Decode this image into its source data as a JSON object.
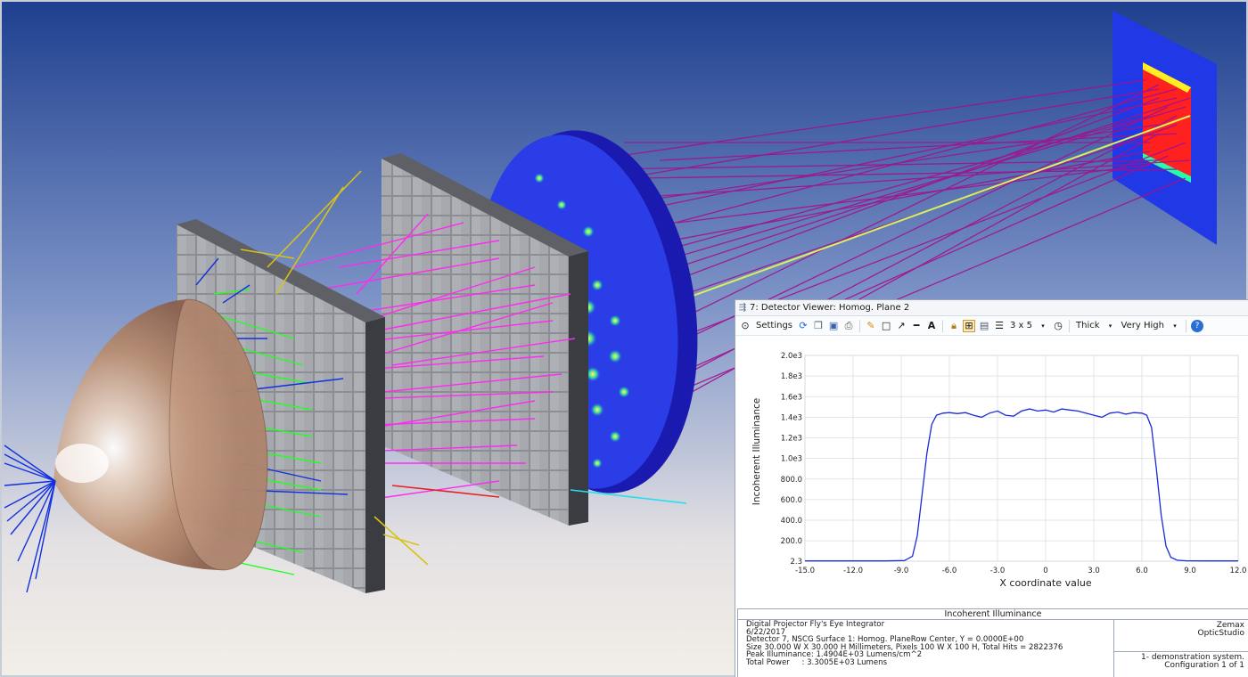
{
  "viewer": {
    "title": "7: Detector Viewer: Homog. Plane 2",
    "toolbar": {
      "settings_label": "Settings",
      "grid_label": "3 x 5",
      "thickness_label": "Thick",
      "quality_label": "Very High"
    }
  },
  "chart_data": {
    "type": "line",
    "xlabel": "X coordinate value",
    "ylabel": "Incoherent Illuminance",
    "xlim": [
      -15,
      12
    ],
    "ylim": [
      2.3,
      2000
    ],
    "x_ticks": [
      "-15.0",
      "-12.0",
      "-9.0",
      "-6.0",
      "-3.0",
      "0",
      "3.0",
      "6.0",
      "9.0",
      "12.0"
    ],
    "y_ticks": [
      "2.3",
      "200.0",
      "400.0",
      "600.0",
      "800.0",
      "1.0e3",
      "1.2e3",
      "1.4e3",
      "1.6e3",
      "1.8e3",
      "2.0e3"
    ],
    "series": [
      {
        "color": "#1a2bd6",
        "x": [
          -15,
          -10,
          -8.8,
          -8.3,
          -8.0,
          -7.7,
          -7.4,
          -7.1,
          -6.8,
          -6.4,
          -6.0,
          -5.5,
          -5.0,
          -4.5,
          -4.0,
          -3.5,
          -3.0,
          -2.5,
          -2.0,
          -1.5,
          -1.0,
          -0.5,
          0,
          0.5,
          1.0,
          1.5,
          2.0,
          2.5,
          3.0,
          3.5,
          4.0,
          4.5,
          5.0,
          5.5,
          6.0,
          6.3,
          6.6,
          6.9,
          7.2,
          7.5,
          7.8,
          8.2,
          8.8,
          10,
          12
        ],
        "y": [
          5,
          5,
          8,
          50,
          250,
          650,
          1050,
          1330,
          1420,
          1440,
          1445,
          1435,
          1445,
          1420,
          1400,
          1440,
          1460,
          1420,
          1410,
          1460,
          1480,
          1460,
          1470,
          1450,
          1480,
          1470,
          1460,
          1440,
          1420,
          1400,
          1440,
          1450,
          1430,
          1445,
          1440,
          1420,
          1300,
          900,
          450,
          150,
          40,
          12,
          6,
          5,
          5
        ]
      }
    ]
  },
  "info": {
    "header": "Incoherent Illuminance",
    "line1": "Digital Projector Fly's Eye Integrator",
    "line2": "6/22/2017",
    "line3": "Detector 7, NSCG Surface 1: Homog. PlaneRow Center, Y = 0.0000E+00",
    "line4": "Size 30.000 W X 30.000 H Millimeters, Pixels 100 W X 100 H, Total Hits = 2822376",
    "line5": "Peak Illuminance: 1.4904E+03 Lumens/cm^2",
    "line6": "Total Power     : 3.3005E+03 Lumens",
    "company": "Zemax",
    "product": "OpticStudio",
    "file": "1- demonstration system.",
    "configuration": "Configuration 1 of 1"
  },
  "colors": {
    "background_top": "#1e3f8f",
    "background_bottom": "#f2eee8",
    "ray_magenta": "#ff2af0",
    "ray_purple": "#a0128f",
    "ray_green": "#22ff22",
    "ray_blue": "#1030e0",
    "ray_yellow": "#d8c21a",
    "plot_line": "#1a2bd6"
  }
}
